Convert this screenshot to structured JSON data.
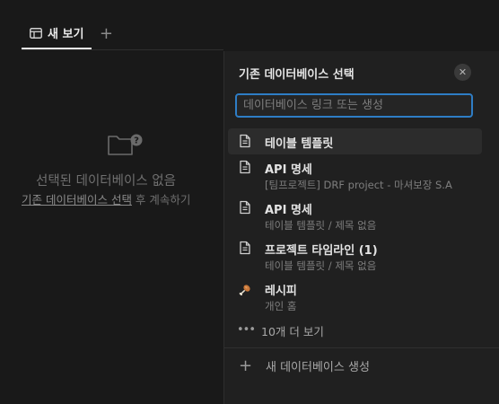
{
  "tabs": [
    {
      "label": "새 보기",
      "icon": "table-icon"
    }
  ],
  "add_tab_icon": "plus-icon",
  "empty_state": {
    "icon": "folder-question-icon",
    "title": "선택된 데이터베이스 없음",
    "subtitle_link": "기존 데이터베이스 선택",
    "subtitle_rest": " 후 계속하기"
  },
  "panel": {
    "title": "기존 데이터베이스 선택",
    "close_icon": "close-icon",
    "search": {
      "placeholder": "데이터베이스 링크 또는 생성",
      "value": ""
    },
    "items": [
      {
        "title": "테이블 템플릿",
        "subtitle": "",
        "icon": "page-icon"
      },
      {
        "title": "API 명세",
        "subtitle": "[팀프로젝트] DRF project - 마셔보장 S.A",
        "icon": "page-icon"
      },
      {
        "title": "API 명세",
        "subtitle": "테이블 템플릿 / 제목 없음",
        "icon": "page-icon"
      },
      {
        "title": "프로젝트 타임라인 (1)",
        "subtitle": "테이블 템플릿 / 제목 없음",
        "icon": "page-icon"
      },
      {
        "title": "레시피",
        "subtitle": "개인 홈",
        "icon": "drumstick-icon"
      }
    ],
    "more_label": "10개 더 보기",
    "create_label": "새 데이터베이스 생성"
  },
  "colors": {
    "background": "#191919",
    "panel": "#202020",
    "accent": "#2e7dc5"
  }
}
